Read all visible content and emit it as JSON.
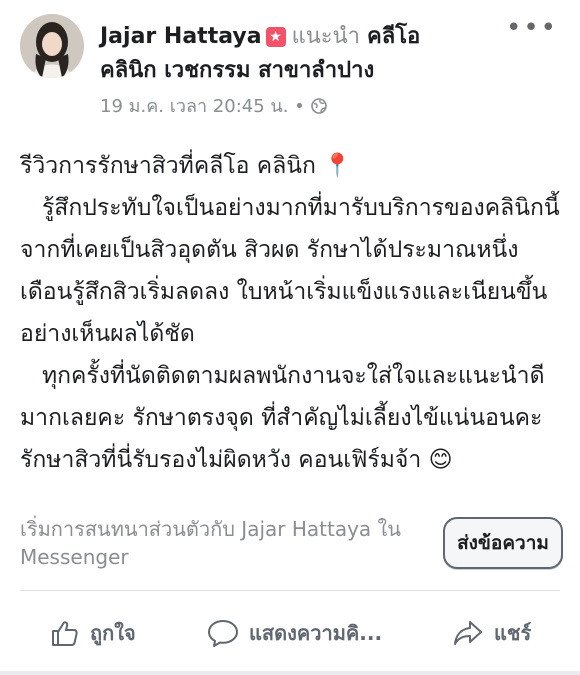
{
  "author": {
    "name": "Jajar Hattaya",
    "recommends": "แนะนำ",
    "page_name_line1": "คลีโอ",
    "page_name_line2": "คลินิก เวชกรรม สาขาลำปาง"
  },
  "meta": {
    "timestamp": "19 ม.ค. เวลา 20:45 น.",
    "separator": "•"
  },
  "post": {
    "paragraphs": [
      "รีวิวการรักษาสิวที่คลีโอ คลินิก 📍",
      "   รู้สึกประทับใจเป็นอย่างมากที่มารับบริการของคลินิกนี้ จากที่เคยเป็นสิวอุดตัน สิวผด รักษาได้ประมาณหนึ่งเดือนรู้สึกสิวเริ่มลดลง ใบหน้าเริ่มแข็งแรงและเนียนขึ้นอย่างเห็นผลได้ชัด",
      "   ทุกครั้งที่นัดติดตามผลพนักงานจะใส่ใจและแนะนำดีมากเลยคะ รักษาตรงจุด ที่สำคัญไม่เลี้ยงไข้แน่นอนคะ รักษาสิวที่นี่รับรองไม่ผิดหวัง คอนเฟิร์มจ้า 😊"
    ]
  },
  "messenger": {
    "prompt": "เริ่มการสนทนาส่วนตัวกับ Jajar Hattaya ใน Messenger",
    "send_label": "ส่งข้อความ"
  },
  "actions": {
    "like": "ถูกใจ",
    "comment": "แสดงความคิ...",
    "share": "แชร์"
  },
  "colors": {
    "badge": "#f35369",
    "muted": "#8a8d91",
    "text": "#1c1e21"
  }
}
